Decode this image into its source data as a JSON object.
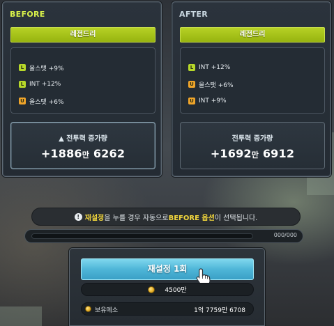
{
  "before": {
    "title": "BEFORE",
    "grade": "레전드리",
    "options": [
      {
        "grade": "L",
        "text": "올스탯 +9%"
      },
      {
        "grade": "L",
        "text": "INT +12%"
      },
      {
        "grade": "U",
        "text": "올스탯 +6%"
      }
    ],
    "power_label": "▲ 전투력 증가량",
    "power_prefix": "+1886",
    "power_unit": "만",
    "power_suffix": " 6262"
  },
  "after": {
    "title": "AFTER",
    "grade": "레전드리",
    "options": [
      {
        "grade": "L",
        "text": "INT +12%"
      },
      {
        "grade": "U",
        "text": "올스탯 +6%"
      },
      {
        "grade": "U",
        "text": "INT +9%"
      }
    ],
    "power_label": "전투력 증가량",
    "power_prefix": "+1692",
    "power_unit": "만",
    "power_suffix": " 6912"
  },
  "notice": {
    "icon": "!",
    "part1": "재설정",
    "part2": "을 누를 경우 자동으로 ",
    "part3": "BEFORE 옵션",
    "part4": "이 선택됩니다."
  },
  "progress": {
    "text": "000/000",
    "fraction": 0
  },
  "reset": {
    "button_label": "재설정 1회",
    "cost": "4500만",
    "meso_label": "보유메소",
    "meso_value": "1억 7759만 6708"
  },
  "colors": {
    "grade_bar": "#a8c41a",
    "legendary_badge": "#b7d82a",
    "unique_badge": "#f0a52a",
    "highlight_yellow": "#f2d63c",
    "reset_button": "#4fb6d8"
  },
  "icons": {
    "notice": "info-icon",
    "cost": "coin-icon",
    "meso": "coin-icon",
    "cursor": "hand-cursor-icon"
  }
}
